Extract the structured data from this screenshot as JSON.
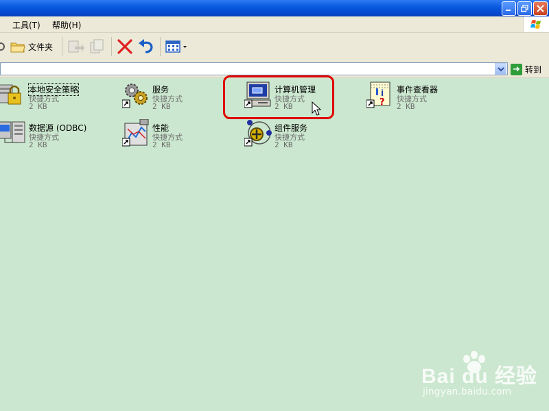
{
  "menu": {
    "tools": "工具(T)",
    "help": "帮助(H)"
  },
  "toolbar": {
    "folders_label": "文件夹"
  },
  "address": {
    "goto_label": "转到"
  },
  "items": [
    {
      "name": "本地安全策略",
      "type": "快捷方式",
      "size": "2 KB",
      "icon": "local-security-policy-icon"
    },
    {
      "name": "服务",
      "type": "快捷方式",
      "size": "2 KB",
      "icon": "services-icon"
    },
    {
      "name": "计算机管理",
      "type": "快捷方式",
      "size": "2 KB",
      "icon": "computer-management-icon"
    },
    {
      "name": "事件查看器",
      "type": "快捷方式",
      "size": "2 KB",
      "icon": "event-viewer-icon"
    },
    {
      "name": "数据源 (ODBC)",
      "type": "快捷方式",
      "size": "2 KB",
      "icon": "odbc-data-source-icon"
    },
    {
      "name": "性能",
      "type": "快捷方式",
      "size": "2 KB",
      "icon": "performance-icon"
    },
    {
      "name": "组件服务",
      "type": "快捷方式",
      "size": "2 KB",
      "icon": "component-services-icon"
    }
  ],
  "watermark": {
    "brand": "Bai du 经验",
    "url": "jingyan.baidu.com"
  },
  "colors": {
    "content_bg": "#cbe7cf",
    "highlight": "#e00000",
    "titlebar": "#0a5be0"
  }
}
